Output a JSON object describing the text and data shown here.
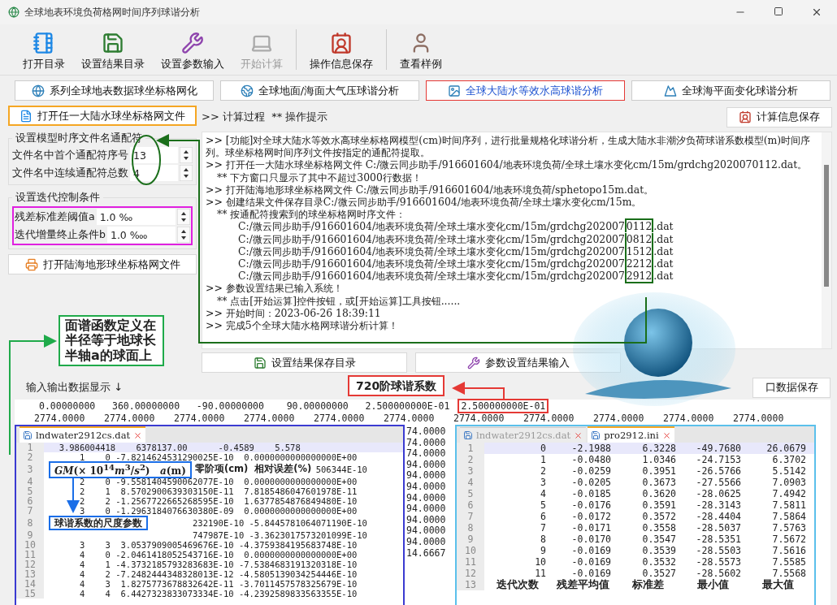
{
  "window": {
    "title": "全球地表环境负荷格网时间序列球谐分析"
  },
  "toolbar": [
    {
      "label": "打开目录",
      "disabled": false
    },
    {
      "label": "设置结果目录",
      "disabled": false
    },
    {
      "label": "设置参数输入",
      "disabled": false
    },
    {
      "label": "开始计算",
      "disabled": true
    },
    {
      "label": "操作信息保存",
      "disabled": false
    },
    {
      "label": "查看样例",
      "disabled": false
    }
  ],
  "tabs": [
    {
      "label": "系列全球地表数据球坐标格网化",
      "selected": false
    },
    {
      "label": "全球地面/海面大气压球谐分析",
      "selected": false
    },
    {
      "label": "全球大陆水等效水高球谐分析",
      "selected": true
    },
    {
      "label": "全球海平面变化球谐分析",
      "selected": false
    }
  ],
  "left_panel": {
    "open_button": "打开任一大陆水球坐标格网文件",
    "groups": [
      {
        "title": "设置模型时序文件名通配符",
        "highlighted": false,
        "fields": [
          {
            "label": "文件名中首个通配符序号",
            "value": "13"
          },
          {
            "label": "文件名中连续通配符总数",
            "value": "4"
          }
        ]
      },
      {
        "title": "设置迭代控制条件",
        "highlighted": true,
        "fields": [
          {
            "label": "残差标准差阈值a",
            "value": "1.0 ‰"
          },
          {
            "label": "迭代增量终止条件b",
            "value": "1.0 ‱"
          }
        ]
      }
    ],
    "terrain_button": "打开陆海地形球坐标格网文件"
  },
  "log": {
    "header": ">> 计算过程  ** 操作提示",
    "save_button": "计算信息保存",
    "lines": [
      {
        "kind": "step",
        "text": ">> [功能]对全球大陆水等效水高球坐标格网模型(cm)时间序列，进行批量规格化球谐分析，生成大陆水非潮汐负荷球谐系数模型(m)时间序列。球坐标格网时间序列文件按指定的通配符提取。"
      },
      {
        "kind": "step",
        "text": ">> 打开任一大陆水球坐标格网文件 C:/微云同步助手/916601604/地表环境负荷/全球土壤水变化cm/15m/grdchg2020070112.dat。"
      },
      {
        "kind": "note",
        "text": "** 下方窗口只显示了其中不超过3000行数据！"
      },
      {
        "kind": "step",
        "text": ">> 打开陆海地形球坐标格网文件 C:/微云同步助手/916601604/地表环境负荷/sphetopo15m.dat。"
      },
      {
        "kind": "step",
        "text": ">> 创建结果文件保存目录C:/微云同步助手/916601604/地表环境负荷/全球土壤水变化cm/15m。"
      },
      {
        "kind": "note",
        "text": "** 按通配符搜索到的球坐标格网时序文件："
      },
      {
        "kind": "file",
        "text": "C:/微云同步助手/916601604/地表环境负荷/全球土壤水变化cm/15m/grdchg202007",
        "mark": "0112",
        "suffix": ".dat"
      },
      {
        "kind": "file",
        "text": "C:/微云同步助手/916601604/地表环境负荷/全球土壤水变化cm/15m/grdchg202007",
        "mark": "0812",
        "suffix": ".dat"
      },
      {
        "kind": "file",
        "text": "C:/微云同步助手/916601604/地表环境负荷/全球土壤水变化cm/15m/grdchg202007",
        "mark": "1512",
        "suffix": ".dat"
      },
      {
        "kind": "file",
        "text": "C:/微云同步助手/916601604/地表环境负荷/全球土壤水变化cm/15m/grdchg202007",
        "mark": "2212",
        "suffix": ".dat"
      },
      {
        "kind": "file",
        "text": "C:/微云同步助手/916601604/地表环境负荷/全球土壤水变化cm/15m/grdchg202007",
        "mark": "2912",
        "suffix": ".dat"
      },
      {
        "kind": "step",
        "text": ">> 参数设置结果已输入系统！"
      },
      {
        "kind": "note",
        "text": "** 点击[开始运算]控件按钮，或[开始运算]工具按钮......"
      },
      {
        "kind": "step",
        "text": ">> 开始时间：2023-06-26 18:39:11"
      },
      {
        "kind": "step",
        "text": ">> 完成5个全球大陆水格网球谐分析计算！"
      }
    ],
    "buttons": [
      "设置结果保存目录",
      "参数设置结果输入"
    ]
  },
  "io": {
    "title": "输入输出数据显示 ↓",
    "save_button": "口数据保存",
    "line_1": "0.00000000   360.00000000   -90.00000000    90.00000000   2.500000000E-01",
    "line_1_boxed": "2.500000000E-01",
    "line_2": [
      "2774.0000",
      "2774.0000",
      "2774.0000",
      "2774.0000",
      "2774.0000",
      "2774.0000",
      "2774.0000",
      "2774.0000",
      "2774.0000",
      "2774.0000",
      "2774.0000"
    ],
    "background_column": [
      "74.0000",
      "74.0000",
      "74.0000",
      "94.0000",
      "94.0000",
      "94.0000",
      "94.0000",
      "94.0000",
      "94.0000",
      "94.0000",
      "94.0000",
      "14.6667"
    ],
    "left_editor": {
      "tabs": [
        {
          "label": "lndwater2912cs.dat",
          "selected": true
        }
      ],
      "rows": [
        {
          "n": "1",
          "kind": "line",
          "text": "  3.986004418    6378137.00      -0.4589    5.578",
          "current": true
        },
        {
          "n": "2",
          "kind": "line",
          "text": "      1    0 -7.8214624531290025E-10  0.0000000000000000E+00",
          "current": false
        },
        {
          "n": "3",
          "kind": "fragment",
          "text": "506344E-10",
          "current": false,
          "notes": [
            {
              "kind": "blue_box",
              "text": "*GM*(× 10$^{14}$*m*$^{3}$/*s*$^{2}$)   *a*(m)"
            },
            {
              "kind": "plain",
              "text": "零阶项(cm)  相对误差(%)"
            }
          ]
        },
        {
          "n": "4",
          "kind": "line",
          "text": "      2    0 -9.5581404590062077E-10  0.0000000000000000E+00",
          "current": false
        },
        {
          "n": "5",
          "kind": "line",
          "text": "      2    1  8.5702900639303150E-11  7.8185486047601978E-11",
          "current": false
        },
        {
          "n": "6",
          "kind": "line",
          "text": "      2    2 -1.2567722665268595E-10  1.6377854876849480E-10",
          "current": false
        },
        {
          "n": "7",
          "kind": "line",
          "text": "      3    0 -1.2963184076630380E-09  0.0000000000000000E+00",
          "current": false
        },
        {
          "n": "8",
          "kind": "fragment",
          "text": "232190E-10 -5.8445781064071190E-10",
          "current": false,
          "notes": [
            {
              "kind": "blue_box",
              "text": "球谐系数的尺度参数"
            }
          ]
        },
        {
          "n": "9",
          "kind": "fragment",
          "text": "747987E-10 -3.3623017573201099E-10",
          "current": false
        },
        {
          "n": "10",
          "kind": "line",
          "text": "      3    3  3.0537909005469676E-10 -4.3759384195683748E-10",
          "current": false
        },
        {
          "n": "11",
          "kind": "line",
          "text": "      4    0 -2.0461418052543716E-10  0.0000000000000000E+00",
          "current": false
        },
        {
          "n": "12",
          "kind": "line",
          "text": "      4    1 -4.3732185793283683E-10 -7.5384683191320318E-10",
          "current": false
        },
        {
          "n": "13",
          "kind": "line",
          "text": "      4    2 -7.2482444348328013E-12 -4.5805139034254446E-10",
          "current": false
        },
        {
          "n": "14",
          "kind": "line",
          "text": "      4    3  1.8275773678832642E-11 -3.7011457578325679E-10",
          "current": false
        },
        {
          "n": "15",
          "kind": "line",
          "text": "      4    4  6.4427323833073334E-10 -4.2392589833563355E-10",
          "current": false
        }
      ]
    },
    "right_editor": {
      "tabs": [
        {
          "label": "lndwater2912cs.dat",
          "selected": false
        },
        {
          "label": "pro2912.ini",
          "selected": true
        }
      ],
      "rows": [
        {
          "n": "1",
          "kind": "data",
          "cells": [
            "0",
            "-2.1988",
            "6.3228",
            "-49.7680",
            "26.0679"
          ],
          "current": true
        },
        {
          "n": "2",
          "kind": "data",
          "cells": [
            "1",
            "-0.0480",
            "1.0346",
            "-24.7153",
            "6.3702"
          ],
          "current": false
        },
        {
          "n": "3",
          "kind": "data",
          "cells": [
            "2",
            "-0.0259",
            "0.3951",
            "-26.5766",
            "5.5142"
          ],
          "current": false
        },
        {
          "n": "4",
          "kind": "data",
          "cells": [
            "3",
            "-0.0205",
            "0.3673",
            "-27.5566",
            "7.0903"
          ],
          "current": false
        },
        {
          "n": "5",
          "kind": "data",
          "cells": [
            "4",
            "-0.0185",
            "0.3620",
            "-28.0625",
            "7.4942"
          ],
          "current": false
        },
        {
          "n": "6",
          "kind": "data",
          "cells": [
            "5",
            "-0.0176",
            "0.3591",
            "-28.3143",
            "7.5811"
          ],
          "current": false
        },
        {
          "n": "7",
          "kind": "data",
          "cells": [
            "6",
            "-0.0172",
            "0.3572",
            "-28.4404",
            "7.5864"
          ],
          "current": false
        },
        {
          "n": "8",
          "kind": "data",
          "cells": [
            "7",
            "-0.0171",
            "0.3558",
            "-28.5037",
            "7.5763"
          ],
          "current": false
        },
        {
          "n": "9",
          "kind": "data",
          "cells": [
            "8",
            "-0.0170",
            "0.3547",
            "-28.5351",
            "7.5672"
          ],
          "current": false
        },
        {
          "n": "10",
          "kind": "data",
          "cells": [
            "9",
            "-0.0169",
            "0.3539",
            "-28.5503",
            "7.5616"
          ],
          "current": false
        },
        {
          "n": "11",
          "kind": "data",
          "cells": [
            "10",
            "-0.0169",
            "0.3532",
            "-28.5573",
            "7.5585"
          ],
          "current": false
        },
        {
          "n": "12",
          "kind": "data",
          "cells": [
            "11",
            "-0.0169",
            "0.3527",
            "-28.5602",
            "7.5568"
          ],
          "current": false
        },
        {
          "n": "13",
          "kind": "caption",
          "cells": [
            "迭代次数",
            "残差平均值",
            "标准差",
            "最小值",
            "最大值"
          ],
          "current": false
        }
      ]
    }
  },
  "annotations": [
    {
      "kind": "green_box",
      "text": "面谱函数定义在半径等于地球长半轴a的球面上"
    },
    {
      "kind": "red_box",
      "text": "720阶球谐系数"
    }
  ]
}
